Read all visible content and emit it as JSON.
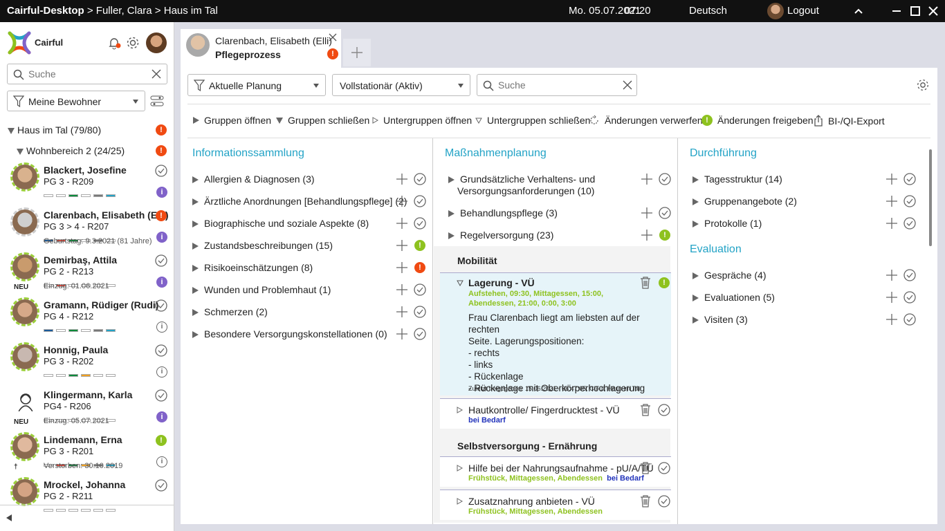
{
  "titlebar": {
    "app": "Cairful-Desktop",
    "crumb": " > Fuller, Clara > Haus im Tal",
    "date": "Mo. 05.07.2021",
    "time": "07:20",
    "language": "Deutsch",
    "logout": "Logout"
  },
  "sidebar": {
    "logo": "Cairful",
    "search_placeholder": "Suche",
    "filter": "Meine Bewohner",
    "tree_root": "Haus im Tal (79/80)",
    "tree_sub": "Wohnbereich 2 (24/25)",
    "residents": [
      {
        "name": "Blackert, Josefine",
        "pg": "PG 3 - R209",
        "info": "",
        "tag": "",
        "status": "check",
        "badge": "i-purple"
      },
      {
        "name": "Clarenbach, Elisabeth (Elli)",
        "pg": "PG 3 > 4 - R207",
        "info": "Geburtstag: 9.3.2021 (81 Jahre)",
        "tag": "",
        "status": "red",
        "badge": "i-purple"
      },
      {
        "name": "Demirbaş, Attila",
        "pg": "PG 2 - R213",
        "info": "Einzug: 01.06.2021",
        "tag": "NEU",
        "status": "check",
        "badge": "i-purple"
      },
      {
        "name": "Gramann, Rüdiger (Rudi)",
        "pg": "PG 4 - R212",
        "info": "",
        "tag": "",
        "status": "check",
        "badge": "i-gray"
      },
      {
        "name": "Honnig, Paula",
        "pg": "PG 3 - R202",
        "info": "",
        "tag": "",
        "status": "check",
        "badge": "i-gray"
      },
      {
        "name": "Klingermann, Karla",
        "pg": "PG4 - R206",
        "info": "Einzug: 05.07.2021",
        "tag": "NEU",
        "status": "check",
        "badge": "i-purple"
      },
      {
        "name": "Lindemann, Erna",
        "pg": "PG 3 - R201",
        "info": "Verstorben: 30.10.2019",
        "tag": "†",
        "status": "green",
        "badge": "i-gray"
      },
      {
        "name": "Mrockel, Johanna",
        "pg": "PG 2 - R211",
        "info": "",
        "tag": "",
        "status": "check",
        "badge": ""
      }
    ]
  },
  "tab": {
    "name": "Clarenbach, Elisabeth (Elli)",
    "subtitle": "Pflegeprozess"
  },
  "filters": {
    "planning": "Aktuelle Planung",
    "stay": "Vollstationär (Aktiv)",
    "search_placeholder": "Suche"
  },
  "toolbar": {
    "open_groups": "Gruppen öffnen",
    "close_groups": "Gruppen schließen",
    "open_sub": "Untergruppen öffnen",
    "close_sub": "Untergruppen schließen",
    "discard": "Änderungen verwerfen",
    "release": "Änderungen freigeben",
    "export": "BI-/QI-Export"
  },
  "info_col": {
    "title": "Informationssammlung",
    "items": [
      "Allergien & Diagnosen (3)",
      "Ärztliche Anordnungen [Behandlungspflege] (2)",
      "Biographische und soziale Aspekte (8)",
      "Zustandsbeschreibungen (15)",
      "Risikoeinschätzungen (8)",
      "Wunden und Problemhaut (1)",
      "Schmerzen (2)",
      "Besondere Versorgungskonstellationen (0)"
    ],
    "states": [
      "check",
      "check",
      "check",
      "green",
      "red",
      "check",
      "check",
      "check"
    ]
  },
  "plan_col": {
    "title": "Maßnahmenplanung",
    "items": [
      {
        "l1": "Grundsätzliche Verhaltens- und",
        "l2": "Versorgungsanforderungen (10)"
      },
      {
        "l1": "Behandlungspflege (3)"
      },
      {
        "l1": "Regelversorgung (23)"
      }
    ],
    "sub1": "Mobilität",
    "lagerung": {
      "title": "Lagerung - VÜ",
      "sched1": "Aufstehen, 09:30, Mittagessen, 15:00,",
      "sched2": "Abendessen, 21:00, 0:00, 3:00",
      "desc": [
        "Frau Clarenbach liegt am liebsten auf der rechten",
        "Seite. Lagerungspositionen:",
        "- rechts",
        "- links",
        "- Rückenlage",
        "- Rückenlage mit Oberkörperhochlagerung"
      ],
      "footer": "Zuletzt freigegeben: 15.06.2021 - 08:47:05, ClFul, Haus im Tal"
    },
    "haut": {
      "title": "Hautkontrolle/ Fingerdrucktest - VÜ",
      "sched": "bei Bedarf"
    },
    "sub2": "Selbstversorgung - Ernährung",
    "hilfe": {
      "title": "Hilfe bei der Nahrungsaufnahme - pU/A/TÜ",
      "sched": "Frühstück, Mittagessen, Abendessen",
      "sched2": "bei Bedarf"
    },
    "zusatz": {
      "title": "Zusatznahrung anbieten - VÜ",
      "sched": "Frühstück, Mittagessen, Abendessen"
    }
  },
  "exec_col": {
    "title": "Durchführung",
    "items": [
      "Tagesstruktur (14)",
      "Gruppenangebote (2)",
      "Protokolle (1)"
    ],
    "eval_title": "Evaluation",
    "eval_items": [
      "Gespräche (4)",
      "Evaluationen (5)",
      "Visiten (3)"
    ]
  },
  "colors": {
    "accent": "#23a3c6",
    "red": "#f04a12",
    "green": "#8ec21f",
    "purple": "#8062c9",
    "highlight": "#e6f4f9"
  }
}
